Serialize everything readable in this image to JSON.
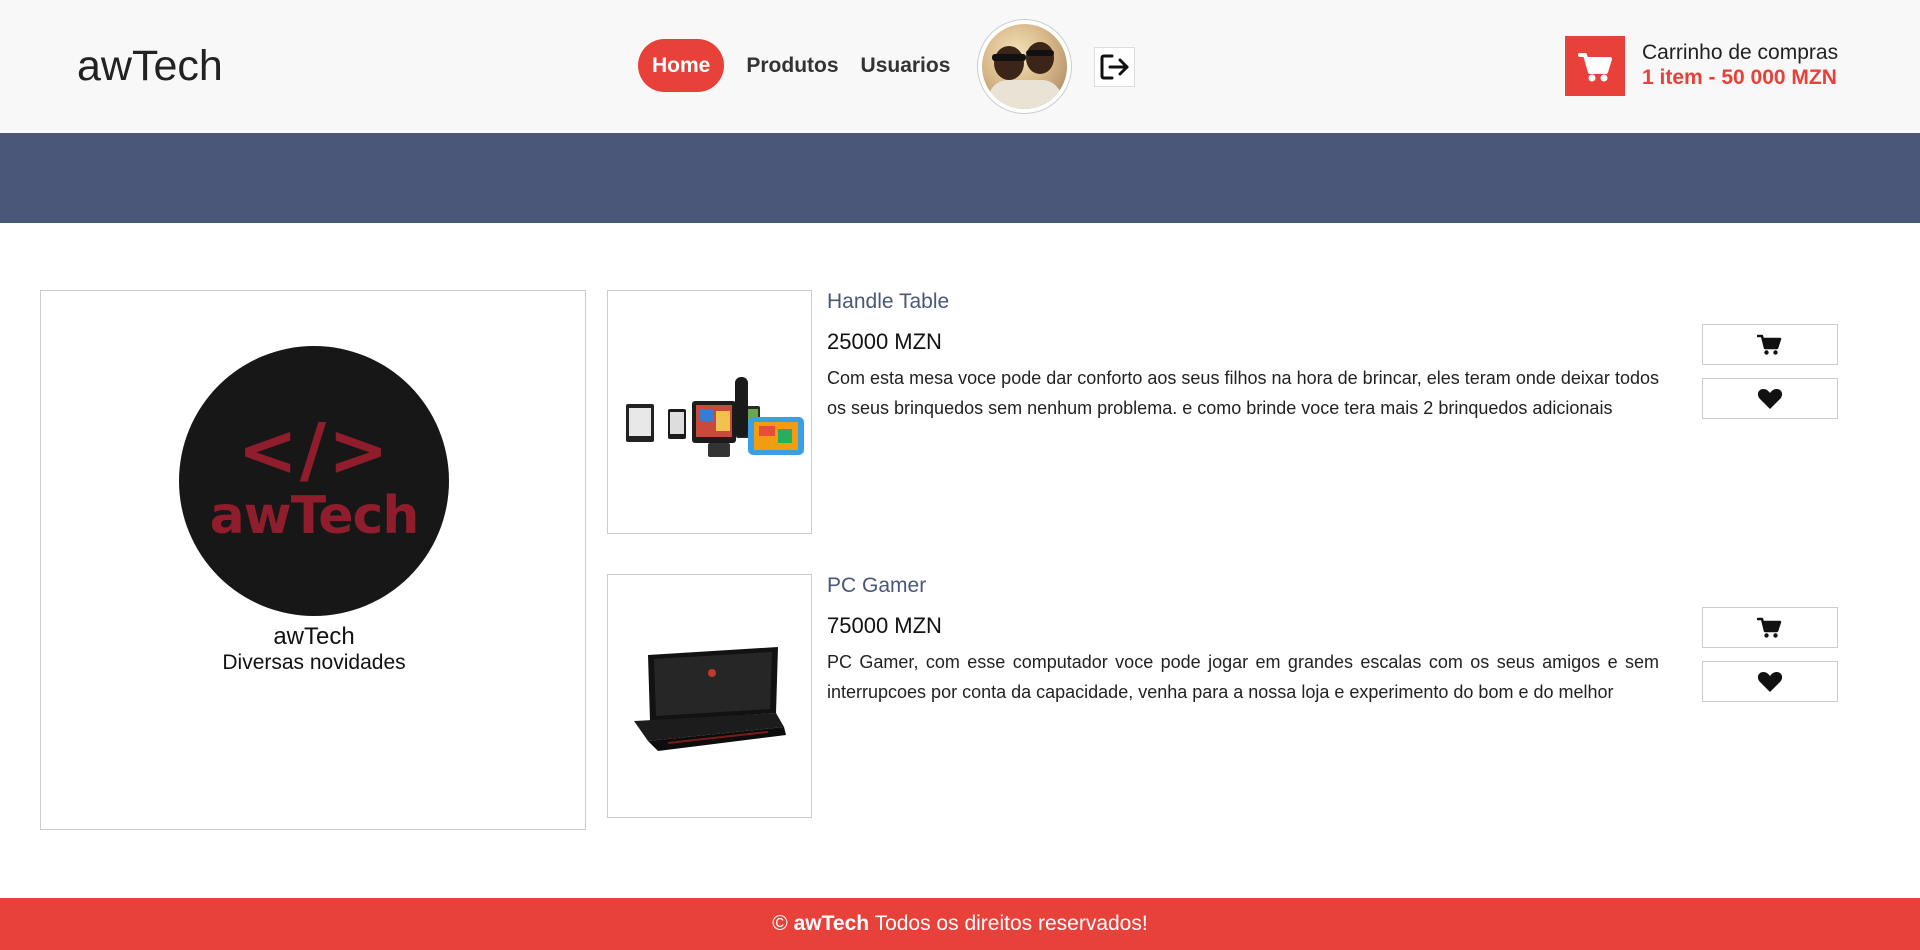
{
  "header": {
    "brand": "awTech",
    "nav": {
      "home": "Home",
      "products": "Produtos",
      "users": "Usuarios"
    },
    "avatar_icon": "user-avatar-photo",
    "logout_icon": "logout-icon",
    "cart": {
      "icon": "shopping-cart-icon",
      "title": "Carrinho de compras",
      "summary": "1 item - 50 000 MZN"
    }
  },
  "store": {
    "logo_code": "</>",
    "logo_text": "awTech",
    "name": "awTech",
    "tagline": "Diversas novidades"
  },
  "products": [
    {
      "name": "Handle Table",
      "price": "25000 MZN",
      "description": "Com esta mesa voce pode dar conforto aos seus filhos na hora de brincar, eles teram onde deixar todos os seus brinquedos sem nenhum problema. e como brinde voce tera mais 2 brinquedos adicionais",
      "image_icon": "tablets-devices-image"
    },
    {
      "name": "PC Gamer",
      "price": "75000 MZN",
      "description": "PC Gamer, com esse computador voce pode jogar em grandes escalas com os seus amigos e sem interrupcoes por conta da capacidade, venha para a nossa loja e experimento do bom e do melhor",
      "image_icon": "gaming-laptop-image"
    }
  ],
  "footer": {
    "copyright": "©",
    "brand": "awTech",
    "text": "Todos os direitos reservados!"
  },
  "colors": {
    "accent": "#e8413a",
    "banner": "#4a5778",
    "header_bg": "#f8f8f8"
  }
}
